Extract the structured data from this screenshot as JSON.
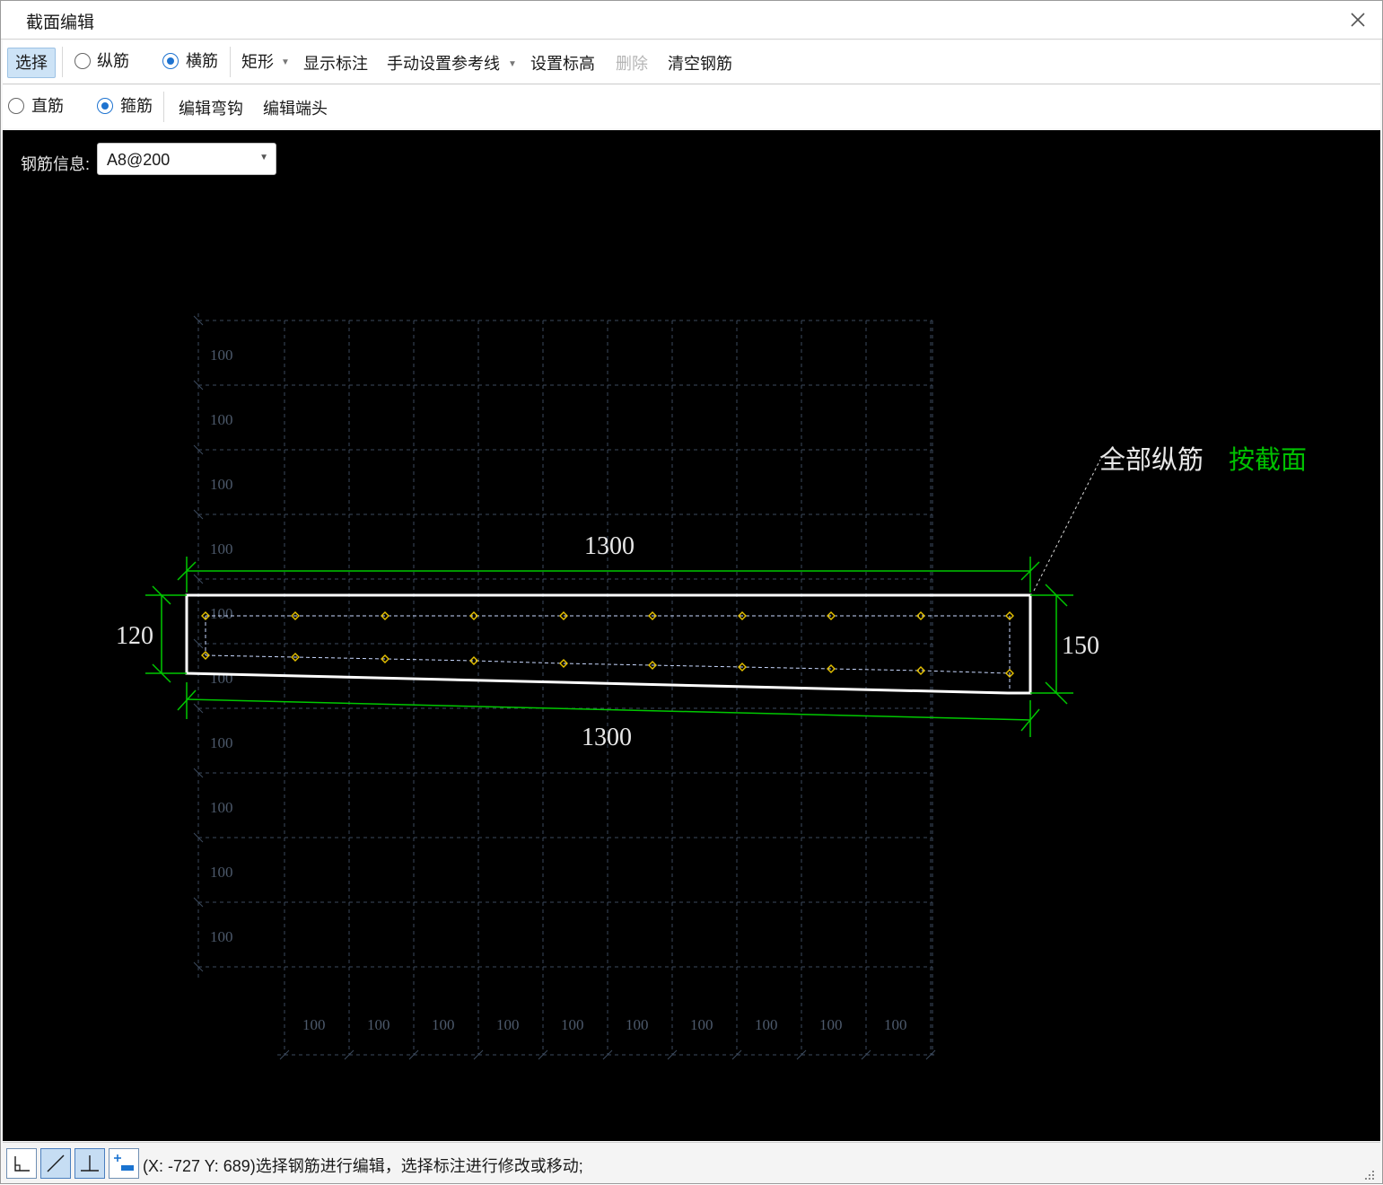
{
  "window": {
    "title": "截面编辑",
    "close_icon": "close-icon"
  },
  "toolbar1": {
    "select_label": "选择",
    "longitudinal_label": "纵筋",
    "transverse_label": "横筋",
    "rect_label": "矩形",
    "show_annotation_label": "显示标注",
    "manual_ref_label": "手动设置参考线",
    "set_elevation_label": "设置标高",
    "delete_label": "删除",
    "clear_rebar_label": "清空钢筋",
    "selected_radio": "横筋"
  },
  "toolbar2": {
    "straight_label": "直筋",
    "stirrup_label": "箍筋",
    "edit_hook_label": "编辑弯钩",
    "edit_end_label": "编辑端头",
    "selected_radio": "箍筋"
  },
  "rebar_info": {
    "label": "钢筋信息:",
    "value": "A8@200"
  },
  "drawing": {
    "grid_labels_vertical": [
      "100",
      "100",
      "100",
      "100",
      "100",
      "100",
      "100",
      "100",
      "100",
      "100"
    ],
    "grid_labels_horizontal": [
      "100",
      "100",
      "100",
      "100",
      "100",
      "100",
      "100",
      "100",
      "100",
      "100"
    ],
    "top_dimension": "1300",
    "bottom_dimension": "1300",
    "left_dimension": "120",
    "right_dimension": "150",
    "callout_white": "全部纵筋",
    "callout_green": "按截面",
    "colors": {
      "grid": "#3c4a5e",
      "dimension": "#00c800",
      "section": "#ffffff",
      "rebar_point": "#e6c200",
      "callout_green": "#00c000"
    }
  },
  "statusbar": {
    "text": "(X: -727 Y: 689)选择钢筋进行编辑，选择标注进行修改或移动;",
    "buttons": [
      "orthogonal-icon",
      "oblique-icon",
      "perpendicular-icon",
      "add-point-icon"
    ]
  }
}
